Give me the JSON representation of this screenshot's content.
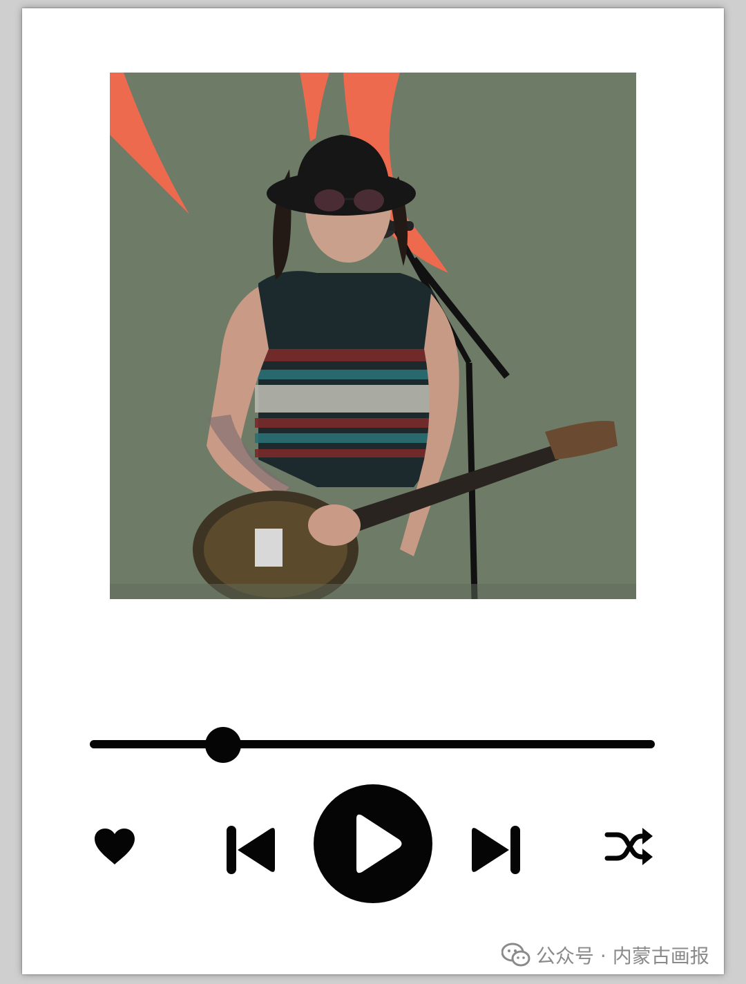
{
  "player": {
    "progress_fraction": 0.236,
    "accent_color": "#050505"
  },
  "controls": {
    "like_icon": "heart-icon",
    "previous_icon": "skip-previous-icon",
    "play_icon": "play-icon",
    "next_icon": "skip-next-icon",
    "shuffle_icon": "shuffle-icon"
  },
  "watermark": {
    "icon": "wechat-icon",
    "text": "公众号 · 内蒙古画报"
  }
}
